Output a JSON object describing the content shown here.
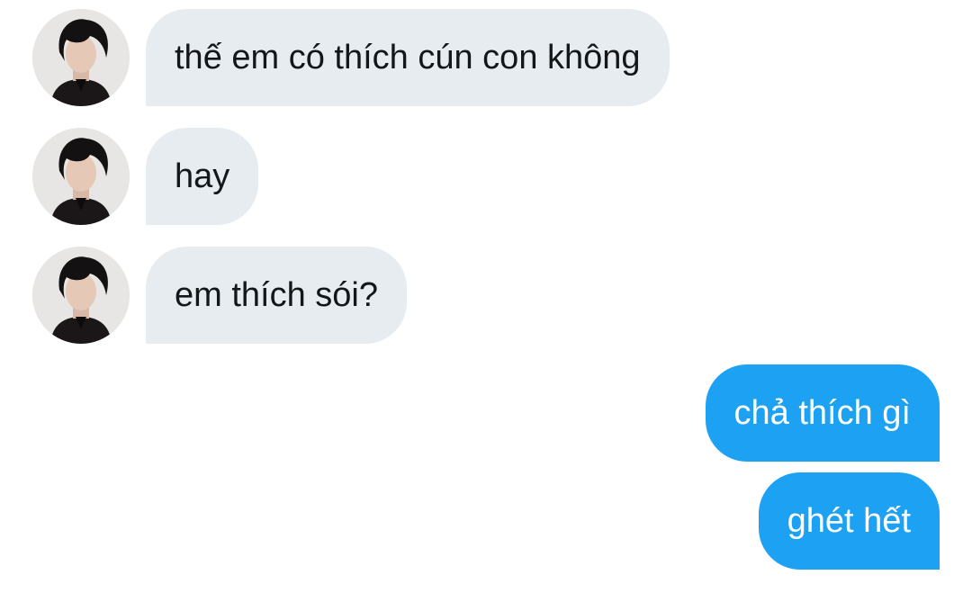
{
  "conversation": {
    "messages": [
      {
        "sender": "them",
        "avatar": "avatar-photo",
        "text": "thế em có thích cún con không"
      },
      {
        "sender": "them",
        "avatar": "avatar-photo",
        "text": "hay"
      },
      {
        "sender": "them",
        "avatar": "avatar-photo",
        "text": "em thích sói?"
      },
      {
        "sender": "me",
        "text": "chả thích gì"
      },
      {
        "sender": "me",
        "text": "ghét hết"
      }
    ]
  },
  "colors": {
    "incoming_bubble": "#e6ecf0",
    "incoming_text": "#14171a",
    "outgoing_bubble": "#1da1f2",
    "outgoing_text": "#ffffff",
    "background": "#ffffff"
  }
}
